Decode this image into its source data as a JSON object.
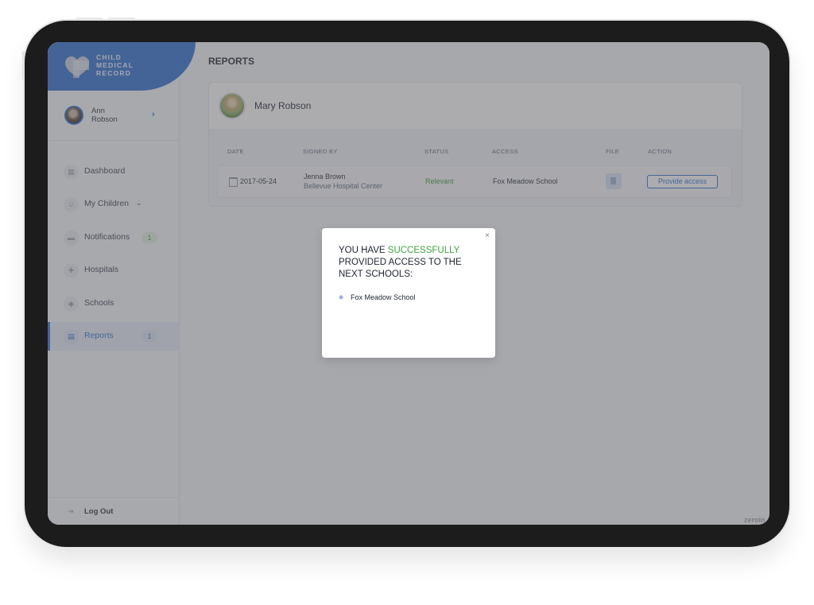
{
  "app": {
    "brand_lines": [
      "CHILD",
      "MEDICAL",
      "RECORD"
    ],
    "brand_color": "#2f6fcf"
  },
  "user": {
    "first_name": "Ann",
    "last_name": "Robson"
  },
  "sidebar": {
    "items": [
      {
        "label": "Dashboard",
        "icon": "dashboard-icon"
      },
      {
        "label": "My Children",
        "icon": "child-face-icon",
        "has_dropdown": true
      },
      {
        "label": "Notifications",
        "icon": "chat-bubble-icon",
        "badge": "1"
      },
      {
        "label": "Hospitals",
        "icon": "hospital-cross-icon"
      },
      {
        "label": "Schools",
        "icon": "graduation-cap-icon"
      },
      {
        "label": "Reports",
        "icon": "clipboard-icon",
        "badge": "1",
        "active": true
      }
    ],
    "logout_label": "Log Out"
  },
  "main": {
    "page_title": "REPORTS",
    "child_name": "Mary Robson",
    "table": {
      "headers": [
        "DATE",
        "SIGNED BY",
        "STATUS",
        "ACCESS",
        "FILE",
        "ACTION"
      ],
      "rows": [
        {
          "date": "2017-05-24",
          "signed_by": "Jenna Brown",
          "signed_by_org": "Bellevue Hospital Center",
          "status": "Relevant",
          "access": "Fox Meadow School",
          "file_icon": "document-icon",
          "action_label": "Provide access"
        }
      ]
    }
  },
  "modal": {
    "title_prefix": "YOU HAVE ",
    "title_highlight": "SUCCESSFULLY",
    "title_suffix": " PROVIDED ACCESS TO THE NEXT SCHOOLS:",
    "schools": [
      "Fox Meadow School"
    ],
    "close_glyph": "×",
    "highlight_color": "#3ea23e"
  },
  "watermark": "zeroin"
}
